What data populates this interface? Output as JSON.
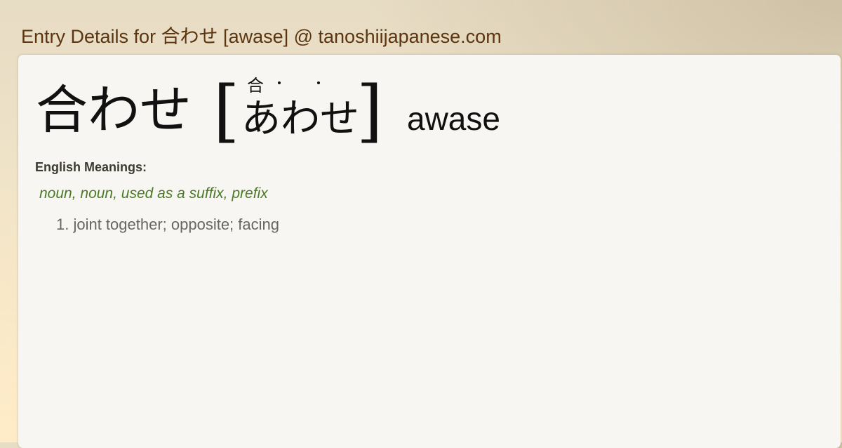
{
  "page": {
    "title": "Entry Details for 合わせ [awase] @ tanoshiijapanese.com"
  },
  "entry": {
    "word": "合わせ",
    "furigana": "合",
    "reading": "あわせ",
    "romaji": "awase",
    "bracket_open": "[",
    "bracket_close": "]"
  },
  "meanings": {
    "label": "English Meanings:",
    "part_of_speech": "noun, noun, used as a suffix, prefix",
    "definitions": [
      "1. joint together; opposite; facing"
    ]
  },
  "colors": {
    "header": "#5b3510",
    "pos": "#4a7a25",
    "definition": "#666666",
    "panel": "#f7f6f2"
  }
}
